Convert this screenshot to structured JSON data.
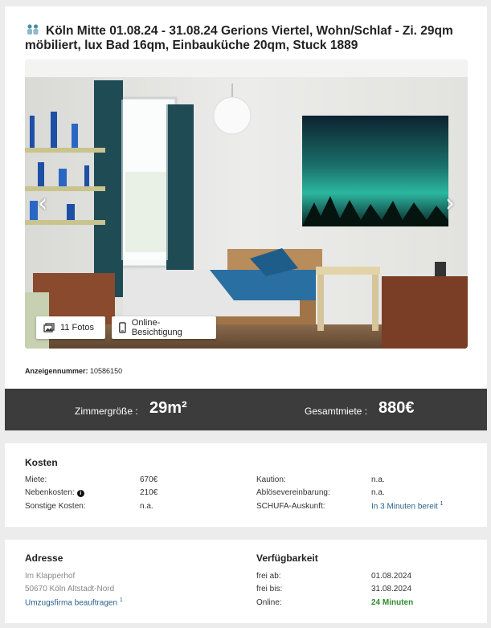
{
  "listing": {
    "title": "Köln Mitte 01.08.24 - 31.08.24 Gerions Viertel, Wohn/Schlaf - Zi. 29qm möbiliert, lux Bad 16qm, Einbauküche 20qm, Stuck 1889",
    "title_icon": "people-icon"
  },
  "gallery": {
    "prev_icon": "‹",
    "next_icon": "›",
    "photos_label": "11 Fotos",
    "online_label": "Online-Besichtigung"
  },
  "ad": {
    "label": "Anzeigennummer:",
    "number": "10586150"
  },
  "stats": {
    "size_label": "Zimmergröße :",
    "size_value": "29m²",
    "rent_label": "Gesamtmiete :",
    "rent_value": "880€"
  },
  "kosten": {
    "heading": "Kosten",
    "rows_left": [
      {
        "label": "Miete:",
        "value": "670€"
      },
      {
        "label": "Nebenkosten:",
        "value": "210€"
      },
      {
        "label": "Sonstige Kosten:",
        "value": "n.a."
      }
    ],
    "rows_right": [
      {
        "label": "Kaution:",
        "value": "n.a."
      },
      {
        "label": "Ablösevereinbarung:",
        "value": "n.a."
      },
      {
        "label": "SCHUFA-Auskunft:",
        "value": "In 3 Minuten bereit",
        "sup": "1"
      }
    ],
    "info_icon": "i"
  },
  "adresse": {
    "heading": "Adresse",
    "street": "Im Klapperhof",
    "city": "50670 Köln Altstadt-Nord",
    "link": "Umzugsfirma beauftragen",
    "link_sup": "1"
  },
  "verfuegbarkeit": {
    "heading": "Verfügbarkeit",
    "rows": [
      {
        "label": "frei ab:",
        "value": "01.08.2024"
      },
      {
        "label": "frei bis:",
        "value": "31.08.2024"
      },
      {
        "label": "Online:",
        "value": "24 Minuten"
      }
    ]
  },
  "colors": {
    "stats_bar": "#3c3c3c",
    "link": "#2b5f8c",
    "online_green": "#2e8b2e",
    "background": "#ececec"
  }
}
